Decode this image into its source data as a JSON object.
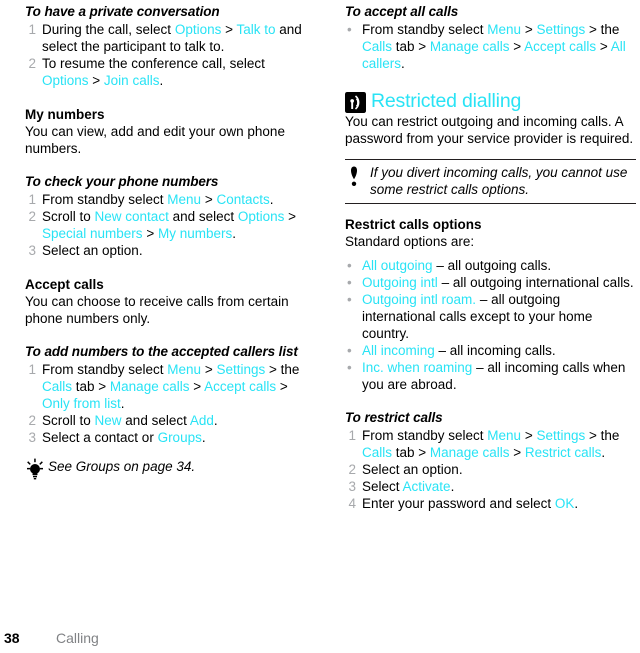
{
  "document": {
    "footer": {
      "page_number": "38",
      "chapter": "Calling"
    }
  },
  "left_column": {
    "proc_private_conversation": {
      "heading": "To have a private conversation",
      "steps": [
        {
          "num": "1",
          "parts": [
            {
              "t": "During the call, select ",
              "s": "plain"
            },
            {
              "t": "Options",
              "s": "ui"
            },
            {
              "t": " > ",
              "s": "plain"
            },
            {
              "t": "Talk to",
              "s": "ui"
            },
            {
              "t": " and select the participant to talk to.",
              "s": "plain"
            }
          ]
        },
        {
          "num": "2",
          "parts": [
            {
              "t": "To resume the conference call, select ",
              "s": "plain"
            },
            {
              "t": "Options",
              "s": "ui"
            },
            {
              "t": " > ",
              "s": "plain"
            },
            {
              "t": "Join calls",
              "s": "ui"
            },
            {
              "t": ".",
              "s": "plain"
            }
          ]
        }
      ]
    },
    "my_numbers": {
      "heading": "My numbers",
      "body": "You can view, add and edit your own phone numbers."
    },
    "proc_check_numbers": {
      "heading": "To check your phone numbers",
      "steps": [
        {
          "num": "1",
          "parts": [
            {
              "t": "From standby select ",
              "s": "plain"
            },
            {
              "t": "Menu",
              "s": "ui"
            },
            {
              "t": " > ",
              "s": "plain"
            },
            {
              "t": "Contacts",
              "s": "ui"
            },
            {
              "t": ".",
              "s": "plain"
            }
          ]
        },
        {
          "num": "2",
          "parts": [
            {
              "t": "Scroll to ",
              "s": "plain"
            },
            {
              "t": "New contact",
              "s": "ui"
            },
            {
              "t": " and select ",
              "s": "plain"
            },
            {
              "t": "Options",
              "s": "ui"
            },
            {
              "t": " > ",
              "s": "plain"
            },
            {
              "t": "Special numbers",
              "s": "ui"
            },
            {
              "t": " > ",
              "s": "plain"
            },
            {
              "t": "My numbers",
              "s": "ui"
            },
            {
              "t": ".",
              "s": "plain"
            }
          ]
        },
        {
          "num": "3",
          "parts": [
            {
              "t": "Select an option.",
              "s": "plain"
            }
          ]
        }
      ]
    },
    "accept_calls": {
      "heading": "Accept calls",
      "body": "You can choose to receive calls from certain phone numbers only."
    },
    "proc_add_accepted": {
      "heading": "To add numbers to the accepted callers list",
      "steps": [
        {
          "num": "1",
          "parts": [
            {
              "t": "From standby select ",
              "s": "plain"
            },
            {
              "t": "Menu",
              "s": "ui"
            },
            {
              "t": " > ",
              "s": "plain"
            },
            {
              "t": "Settings",
              "s": "ui"
            },
            {
              "t": " > the ",
              "s": "plain"
            },
            {
              "t": "Calls",
              "s": "ui"
            },
            {
              "t": " tab > ",
              "s": "plain"
            },
            {
              "t": "Manage calls",
              "s": "ui"
            },
            {
              "t": " > ",
              "s": "plain"
            },
            {
              "t": "Accept calls",
              "s": "ui"
            },
            {
              "t": " > ",
              "s": "plain"
            },
            {
              "t": "Only from list",
              "s": "ui"
            },
            {
              "t": ".",
              "s": "plain"
            }
          ]
        },
        {
          "num": "2",
          "parts": [
            {
              "t": "Scroll to ",
              "s": "plain"
            },
            {
              "t": "New",
              "s": "ui"
            },
            {
              "t": " and select ",
              "s": "plain"
            },
            {
              "t": "Add",
              "s": "ui"
            },
            {
              "t": ".",
              "s": "plain"
            }
          ]
        },
        {
          "num": "3",
          "parts": [
            {
              "t": "Select a contact or ",
              "s": "plain"
            },
            {
              "t": "Groups",
              "s": "ui"
            },
            {
              "t": ".",
              "s": "plain"
            }
          ]
        }
      ]
    },
    "tip": {
      "icon": "lightbulb-icon",
      "text": "See Groups on page 34."
    }
  },
  "right_column": {
    "proc_accept_all": {
      "heading": "To accept all calls",
      "bullets": [
        {
          "parts": [
            {
              "t": "From standby select ",
              "s": "plain"
            },
            {
              "t": "Menu",
              "s": "ui"
            },
            {
              "t": " > ",
              "s": "plain"
            },
            {
              "t": "Settings",
              "s": "ui"
            },
            {
              "t": " > the ",
              "s": "plain"
            },
            {
              "t": "Calls",
              "s": "ui"
            },
            {
              "t": " tab > ",
              "s": "plain"
            },
            {
              "t": "Manage calls",
              "s": "ui"
            },
            {
              "t": " > ",
              "s": "plain"
            },
            {
              "t": "Accept calls",
              "s": "ui"
            },
            {
              "t": " > ",
              "s": "plain"
            },
            {
              "t": "All callers",
              "s": "ui"
            },
            {
              "t": ".",
              "s": "plain"
            }
          ]
        }
      ]
    },
    "restricted_dialling": {
      "icon": "signal-waves-icon",
      "title": "Restricted dialling",
      "body": "You can restrict outgoing and incoming calls. A password from your service provider is required."
    },
    "note": {
      "icon": "exclamation-icon",
      "text": "If you divert incoming calls, you cannot use some restrict calls options."
    },
    "restrict_options": {
      "heading": "Restrict calls options",
      "intro": "Standard options are:",
      "items": [
        {
          "parts": [
            {
              "t": "All outgoing",
              "s": "ui"
            },
            {
              "t": " – all outgoing calls.",
              "s": "plain"
            }
          ]
        },
        {
          "parts": [
            {
              "t": "Outgoing intl",
              "s": "ui"
            },
            {
              "t": " – all outgoing international calls.",
              "s": "plain"
            }
          ]
        },
        {
          "parts": [
            {
              "t": "Outgoing intl roam.",
              "s": "ui"
            },
            {
              "t": " – all outgoing international calls except to your home country.",
              "s": "plain"
            }
          ]
        },
        {
          "parts": [
            {
              "t": "All incoming",
              "s": "ui"
            },
            {
              "t": " – all incoming calls.",
              "s": "plain"
            }
          ]
        },
        {
          "parts": [
            {
              "t": "Inc. when roaming",
              "s": "ui"
            },
            {
              "t": " – all incoming calls when you are abroad.",
              "s": "plain"
            }
          ]
        }
      ]
    },
    "proc_restrict_calls": {
      "heading": "To restrict calls",
      "steps": [
        {
          "num": "1",
          "parts": [
            {
              "t": "From standby select ",
              "s": "plain"
            },
            {
              "t": "Menu",
              "s": "ui"
            },
            {
              "t": " > ",
              "s": "plain"
            },
            {
              "t": "Settings",
              "s": "ui"
            },
            {
              "t": " > the ",
              "s": "plain"
            },
            {
              "t": "Calls",
              "s": "ui"
            },
            {
              "t": " tab > ",
              "s": "plain"
            },
            {
              "t": "Manage calls",
              "s": "ui"
            },
            {
              "t": " > ",
              "s": "plain"
            },
            {
              "t": "Restrict calls",
              "s": "ui"
            },
            {
              "t": ".",
              "s": "plain"
            }
          ]
        },
        {
          "num": "2",
          "parts": [
            {
              "t": "Select an option.",
              "s": "plain"
            }
          ]
        },
        {
          "num": "3",
          "parts": [
            {
              "t": "Select ",
              "s": "plain"
            },
            {
              "t": "Activate",
              "s": "ui"
            },
            {
              "t": ".",
              "s": "plain"
            }
          ]
        },
        {
          "num": "4",
          "parts": [
            {
              "t": "Enter your password and select ",
              "s": "plain"
            },
            {
              "t": "OK",
              "s": "ui"
            },
            {
              "t": ".",
              "s": "plain"
            }
          ]
        }
      ]
    }
  },
  "colors": {
    "ui_accent": "#29e3f5",
    "list_number": "#a7a9ac",
    "footer_chapter": "#808285",
    "text": "#000000"
  }
}
